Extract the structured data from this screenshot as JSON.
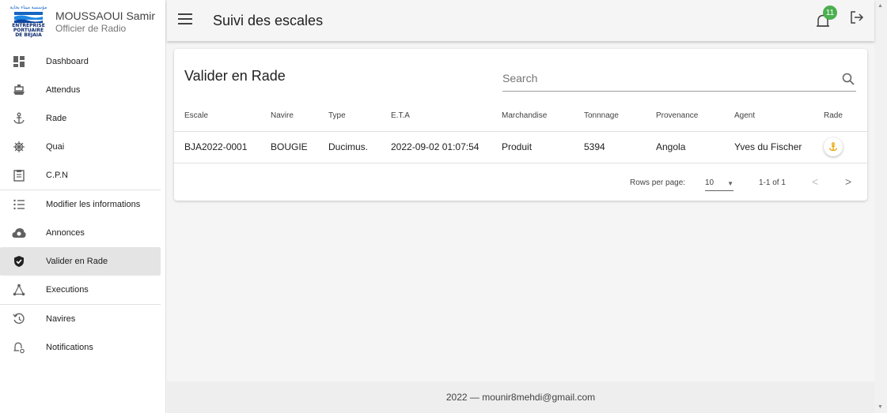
{
  "profile": {
    "logo_arabic": "مؤسسة ميناء بجاية",
    "logo_lines": [
      "ENTREPRISE",
      "PORTUAIRE",
      "DE BEJAIA"
    ],
    "name": "MOUSSAOUI Samir",
    "role": "Officier de Radio"
  },
  "sidebar": {
    "items": [
      {
        "label": "Dashboard",
        "icon": "dashboard-icon"
      },
      {
        "label": "Attendus",
        "icon": "ship-icon"
      },
      {
        "label": "Rade",
        "icon": "anchor-icon"
      },
      {
        "label": "Quai",
        "icon": "helm-icon"
      },
      {
        "label": "C.P.N",
        "icon": "clipboard-icon"
      },
      {
        "label": "Modifier les informations",
        "icon": "list-icon"
      },
      {
        "label": "Annonces",
        "icon": "cloud-icon"
      },
      {
        "label": "Valider en Rade",
        "icon": "verified-icon"
      },
      {
        "label": "Executions",
        "icon": "network-icon"
      },
      {
        "label": "Navires",
        "icon": "history-icon"
      },
      {
        "label": "Notifications",
        "icon": "bell-settings-icon"
      }
    ]
  },
  "topbar": {
    "title": "Suivi des escales",
    "notification_count": "11"
  },
  "card": {
    "title": "Valider en Rade",
    "search_placeholder": "Search"
  },
  "table": {
    "headers": [
      "Escale",
      "Navire",
      "Type",
      "E.T.A",
      "Marchandise",
      "Tonnnage",
      "Provenance",
      "Agent",
      "Rade"
    ],
    "rows": [
      {
        "escale": "BJA2022-0001",
        "navire": "BOUGIE",
        "type": "Ducimus.",
        "eta": "2022-09-02 01:07:54",
        "marchandise": "Produit",
        "tonnage": "5394",
        "provenance": "Angola",
        "agent": "Yves du Fischer",
        "rade_icon": "anchor-icon"
      }
    ]
  },
  "pagination": {
    "rows_per_page_label": "Rows per page:",
    "rows_per_page": "10",
    "range": "1-1 of 1"
  },
  "footer": {
    "text": "2022 — mounir8mehdi@gmail.com"
  },
  "colors": {
    "accent_anchor": "#e8a400",
    "badge": "#4caf50",
    "active_item_bg": "#e4e4e4"
  }
}
